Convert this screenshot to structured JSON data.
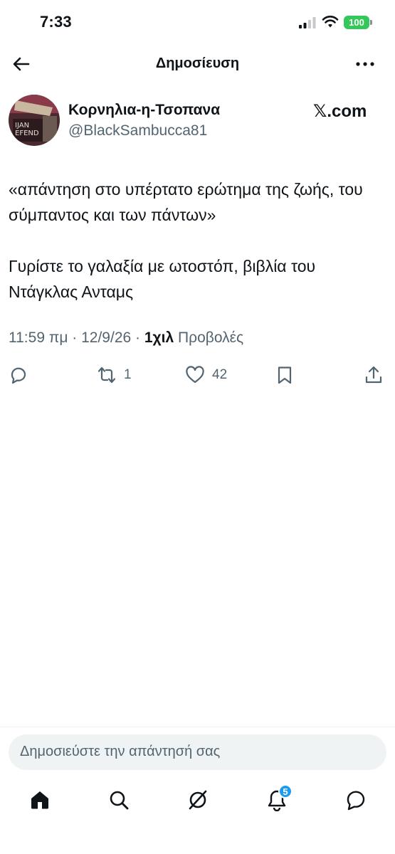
{
  "status_bar": {
    "time": "7:33",
    "battery": "100",
    "battery_color": "#34c759"
  },
  "header": {
    "title": "Δημοσίευση",
    "back_icon": "arrow-left-icon",
    "more_icon": "more-horizontal-icon"
  },
  "author": {
    "display_name": "Κορνηλια-η-Τσοπανα",
    "handle": "@BlackSambucca81",
    "source": "𝕏.com"
  },
  "tweet": {
    "paragraphs": [
      "«απάντηση στο υπέρτατο ερώτημα της ζωής, του σύμπαντος και των πάντων»",
      "Γυρίστε το γαλαξία με ωτοστόπ, βιβλία του Ντάγκλας Ανταμς"
    ],
    "time": "11:59 πμ",
    "separator": "·",
    "date": "12/9/26",
    "views_count": "1χιλ",
    "views_label": "Προβολές"
  },
  "actions": {
    "reply_icon": "reply-icon",
    "retweet_icon": "retweet-icon",
    "retweet_count": "1",
    "like_icon": "heart-icon",
    "like_count": "42",
    "bookmark_icon": "bookmark-icon",
    "share_icon": "share-icon"
  },
  "reply_input": {
    "placeholder": "Δημοσιεύστε την απάντησή σας"
  },
  "tabbar": {
    "items": [
      "home-icon",
      "search-icon",
      "grok-icon",
      "notifications-icon",
      "messages-icon"
    ],
    "notifications_badge": "5",
    "accent_color": "#1d9bf0"
  }
}
